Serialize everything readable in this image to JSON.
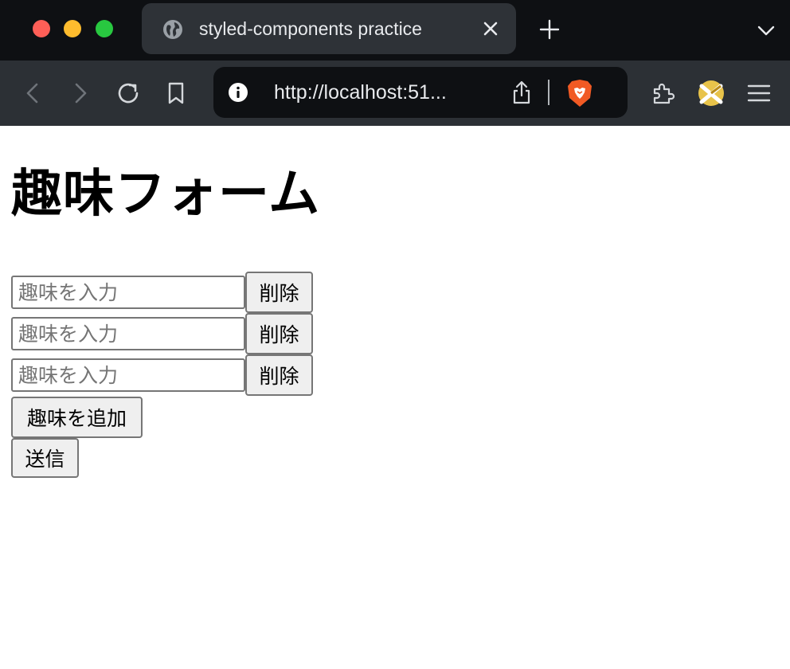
{
  "browser": {
    "tab": {
      "title": "styled-components practice"
    },
    "address_bar": {
      "url": "http://localhost:51..."
    },
    "colors": {
      "close": "#fe5f57",
      "minimize": "#febc2e",
      "maximize": "#28c840",
      "chrome_bg": "#0e1013",
      "toolbar_bg": "#2c3035",
      "brave_orange": "#f15a24"
    }
  },
  "page": {
    "title": "趣味フォーム",
    "hobbies": [
      {
        "value": "",
        "placeholder": "趣味を入力",
        "delete_label": "削除"
      },
      {
        "value": "",
        "placeholder": "趣味を入力",
        "delete_label": "削除"
      },
      {
        "value": "",
        "placeholder": "趣味を入力",
        "delete_label": "削除"
      }
    ],
    "add_label": "趣味を追加",
    "submit_label": "送信"
  }
}
